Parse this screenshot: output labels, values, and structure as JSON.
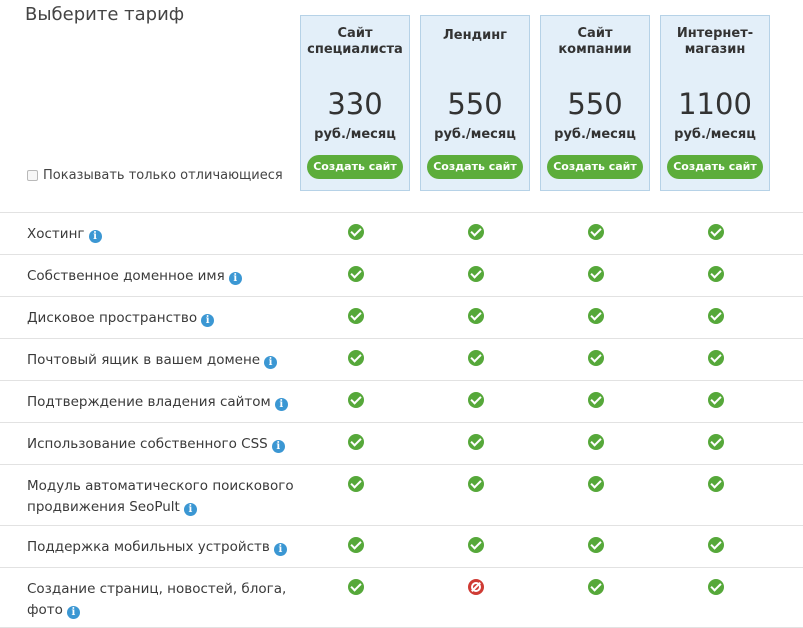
{
  "page": {
    "title": "Выберите тариф",
    "filter_label": "Показывать только отличающиеся",
    "filter_checked": false
  },
  "plans": [
    {
      "name": "Сайт\nспециалиста",
      "price": "330",
      "unit": "руб./месяц",
      "button": "Создать сайт"
    },
    {
      "name": "Лендинг",
      "price": "550",
      "unit": "руб./месяц",
      "button": "Создать сайт"
    },
    {
      "name": "Сайт\nкомпании",
      "price": "550",
      "unit": "руб./месяц",
      "button": "Создать сайт"
    },
    {
      "name": "Интернет-\nмагазин",
      "price": "1100",
      "unit": "руб./месяц",
      "button": "Создать сайт"
    }
  ],
  "info_icon_glyph": "i",
  "features": [
    {
      "label": "Хостинг",
      "values": [
        true,
        true,
        true,
        true
      ]
    },
    {
      "label": "Собственное доменное имя",
      "values": [
        true,
        true,
        true,
        true
      ]
    },
    {
      "label": "Дисковое пространство",
      "values": [
        true,
        true,
        true,
        true
      ]
    },
    {
      "label": "Почтовый ящик в вашем домене",
      "values": [
        true,
        true,
        true,
        true
      ]
    },
    {
      "label": "Подтверждение владения сайтом",
      "values": [
        true,
        true,
        true,
        true
      ]
    },
    {
      "label": "Использование собственного CSS",
      "values": [
        true,
        true,
        true,
        true
      ]
    },
    {
      "label": "Модуль автоматического поискового\nпродвижения SeoPult",
      "values": [
        true,
        true,
        true,
        true
      ]
    },
    {
      "label": "Поддержка мобильных устройств",
      "values": [
        true,
        true,
        true,
        true
      ]
    },
    {
      "label": "Создание страниц, новостей, блога,\nфото",
      "values": [
        true,
        false,
        true,
        true
      ]
    }
  ],
  "colors": {
    "plan_bg": "#e3eff9",
    "button_green": "#5cad3b",
    "check_green": "#56a83a",
    "forbidden_red": "#cf3b34",
    "info_blue": "#3b97d3"
  }
}
